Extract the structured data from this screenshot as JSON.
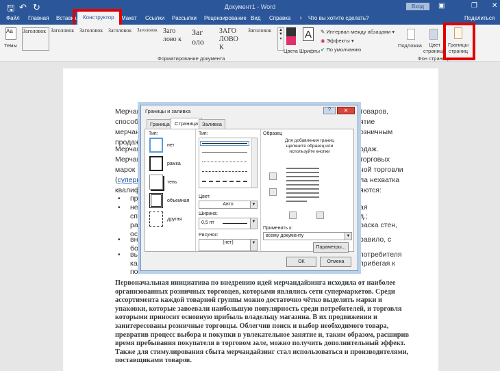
{
  "window": {
    "title": "Документ1 - Word",
    "signin": "Вход"
  },
  "tabs": [
    "Файл",
    "Главная",
    "Вставка",
    "Конструктор",
    "Макет",
    "Ссылки",
    "Рассылки",
    "Рецензирование",
    "Вид",
    "Справка"
  ],
  "tell_me": "Что вы хотите сделать?",
  "share": "Поделиться",
  "ribbon": {
    "themes": "Темы",
    "styles": [
      "Заголовок",
      "Заголовок",
      "Заголовок",
      "Заголовок",
      "Заголовок",
      "Заго лово к",
      "Заг оло",
      "ЗАГО ЛОВО К",
      "Заголовок"
    ],
    "colors": "Цвета",
    "fonts": "Шрифты",
    "paragraph_spacing": "Интервал между абзацами",
    "effects": "Эффекты",
    "default": "По умолчанию",
    "group_format": "Форматирование документа",
    "watermark": "Подложка",
    "page_color_1": "Цвет",
    "page_color_2": "страницы",
    "page_borders_1": "Границы",
    "page_borders_2": "страниц",
    "group_bg": "Фон страницы"
  },
  "document": {
    "left_frags": [
      "Мерчанд",
      "способы",
      "мерчанд",
      "продажа",
      "Мерчанд",
      "Мерчанд",
      "марок на",
      "(суперма",
      "квалифи",
      "пред",
      "необ",
      "спец",
      "расс",
      "осве",
      "внут",
      "боле",
      "выкл",
      "как м",
      "помо"
    ],
    "right_frags": [
      "товаров,",
      "ятие",
      "озничным",
      "одаж.",
      "торговых",
      "ной торговли",
      "ла нехватка",
      "яются:",
      "ая",
      "д.;",
      "раска стен,",
      "равило, с",
      "потребителя",
      "прибегая к"
    ],
    "paragraph": [
      "Первоначальная инициатива по внедрению идей мерчандайзинга исходила от наиболее",
      "организованных розничных торговцев, которыми являлись сети супермаркетов. Среди",
      "ассортимента каждой товарной группы можно достаточно чётко выделить марки и",
      "упаковки, которые завоевали наибольшую популярность среди потребителей, и торговля",
      "которыми приносит основную прибыль владельцу магазина. В их продвижении и",
      "заинтересованы розничные торговцы. Облегчив поиск и выбор необходимого товара,",
      "превратив процесс выбора и покупки в увлекательное занятие и, таким образом, расширив",
      "время пребывания покупателя в торговом зале, можно получить дополнительный эффект.",
      "Также для стимулирования сбыта мерчандайзинг стал использоваться и производителями,",
      "поставщиками товаров."
    ]
  },
  "dialog": {
    "title": "Границы и заливка",
    "tabs": [
      "Граница",
      "Страница",
      "Заливка"
    ],
    "type_label": "Тип:",
    "types": [
      "нет",
      "рамка",
      "тень",
      "объемная",
      "другая"
    ],
    "line_type_label": "Тип:",
    "color_label": "Цвет:",
    "color_value": "Авто",
    "width_label": "Ширина:",
    "width_value": "0,5 пт",
    "art_label": "Рисунок:",
    "art_value": "(нет)",
    "preview_label": "Образец",
    "preview_hint": "Для добавления границ щелкните образец или используйте кнопки",
    "apply_label": "Применить к:",
    "apply_value": "всему документу",
    "options": "Параметры...",
    "ok": "ОК",
    "cancel": "Отмена"
  }
}
